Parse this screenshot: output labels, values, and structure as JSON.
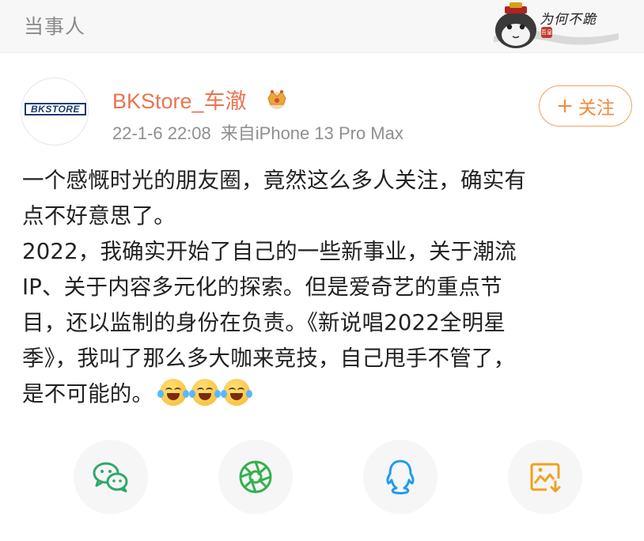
{
  "header": {
    "title": "当事人",
    "watermark_text": "为何不跪",
    "watermark_seal": "吾皇"
  },
  "post": {
    "avatar_text": "BKSTORE",
    "username": "BKStore_车澈",
    "badge_icon": "crown-icon",
    "date": "22-1-6 22:08",
    "source": "来自iPhone 13 Pro Max",
    "follow_label": "关注",
    "follow_plus": "+",
    "body_lines": [
      "一个感慨时光的朋友圈，竟然这么多人关注，确实有",
      "点不好意思了。",
      "2022，我确实开始了自己的一些新事业，关于潮流",
      "IP、关于内容多元化的探索。但是爱奇艺的重点节",
      "目，还以监制的身份在负责。《新说唱2022全明星",
      "季》，我叫了那么多大咖来竞技，自己甩手不管了，",
      "是不可能的。"
    ],
    "emoji_count": 3,
    "emoji_icon": "laughing-tears-emoji"
  },
  "share": {
    "buttons": [
      {
        "icon": "wechat-icon",
        "color": "#2ea86b"
      },
      {
        "icon": "moments-icon",
        "color": "#34b04c"
      },
      {
        "icon": "qq-icon",
        "color": "#1e9bf0"
      },
      {
        "icon": "save-image-icon",
        "color": "#f0a11e"
      }
    ]
  }
}
